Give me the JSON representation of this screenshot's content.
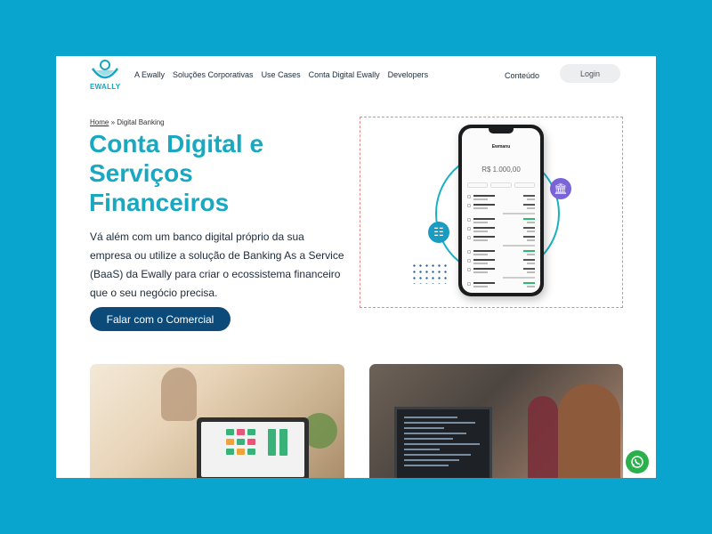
{
  "brand": {
    "name": "EWALLY",
    "accent": "#1aa8c0",
    "background": "#0aa5cf"
  },
  "nav": {
    "items": [
      "A Ewally",
      "Soluções Corporativas",
      "Use Cases",
      "Conta Digital Ewally",
      "Developers"
    ],
    "conteudo": "Conteúdo",
    "login": "Login"
  },
  "breadcrumb": {
    "home": "Home",
    "separator": "»",
    "current": "Digital Banking"
  },
  "hero": {
    "title": "Conta Digital e Serviços Financeiros",
    "description": "Vá além com um banco digital próprio da sua empresa ou utilize a solução de Banking As a Service (BaaS) da Ewally para criar o ecossistema financeiro que o seu negócio precisa.",
    "cta": "Falar com o Comercial",
    "cta_color": "#0c4a7a"
  },
  "illustration": {
    "phone_app_title": "Ewmanu",
    "phone_balance": "R$ 1.000,00",
    "left_badge_icon": "money-icon",
    "right_badge_icon": "bank-icon"
  },
  "images": [
    "office-tablet-photo",
    "developers-coding-photo"
  ],
  "whatsapp": {
    "icon": "whatsapp-icon",
    "color": "#2bb14b"
  }
}
